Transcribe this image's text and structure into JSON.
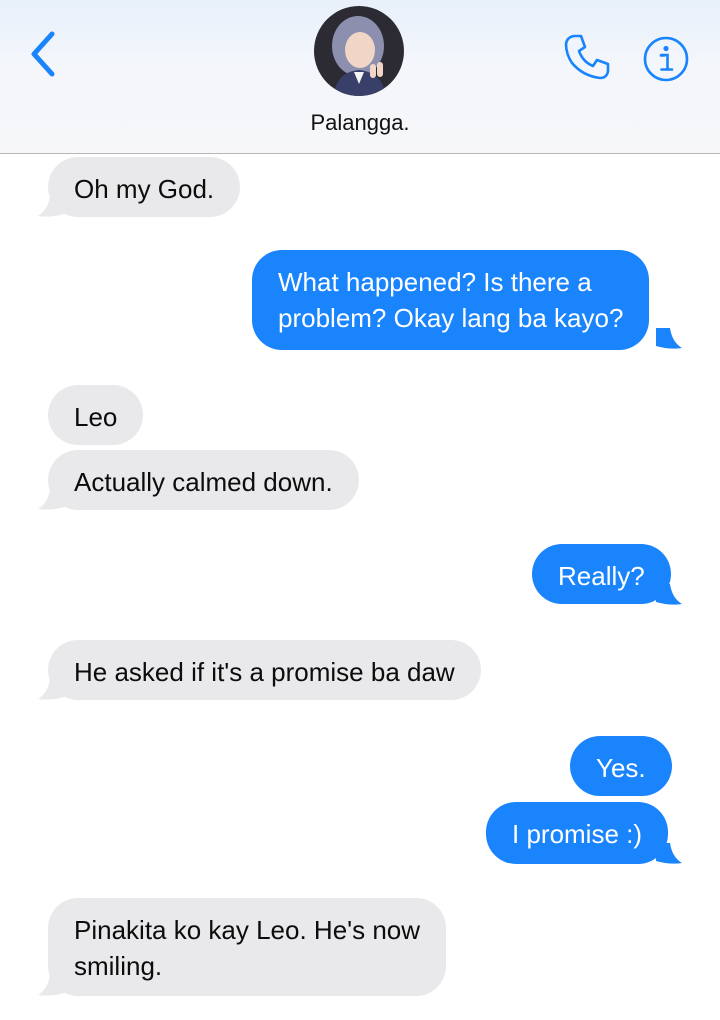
{
  "header": {
    "contact_name": "Palangga.",
    "back_icon": "chevron-left-icon",
    "call_icon": "phone-icon",
    "info_icon": "info-icon",
    "accent_color": "#1a84fd"
  },
  "messages": [
    {
      "side": "incoming",
      "text": "Oh my God."
    },
    {
      "side": "outgoing",
      "lines": [
        "What happened? Is there a",
        "problem? Okay lang ba kayo?"
      ]
    },
    {
      "side": "incoming",
      "text": "Leo"
    },
    {
      "side": "incoming",
      "text": "Actually calmed down."
    },
    {
      "side": "outgoing",
      "text": "Really?"
    },
    {
      "side": "incoming",
      "text": "He asked if it's a promise ba daw"
    },
    {
      "side": "outgoing",
      "text": "Yes."
    },
    {
      "side": "outgoing",
      "text": "I promise :)"
    },
    {
      "side": "incoming",
      "lines": [
        "Pinakita ko kay Leo. He's now",
        "smiling."
      ]
    }
  ],
  "colors": {
    "incoming_bubble": "#e9e9eb",
    "outgoing_bubble": "#1a84fd"
  }
}
